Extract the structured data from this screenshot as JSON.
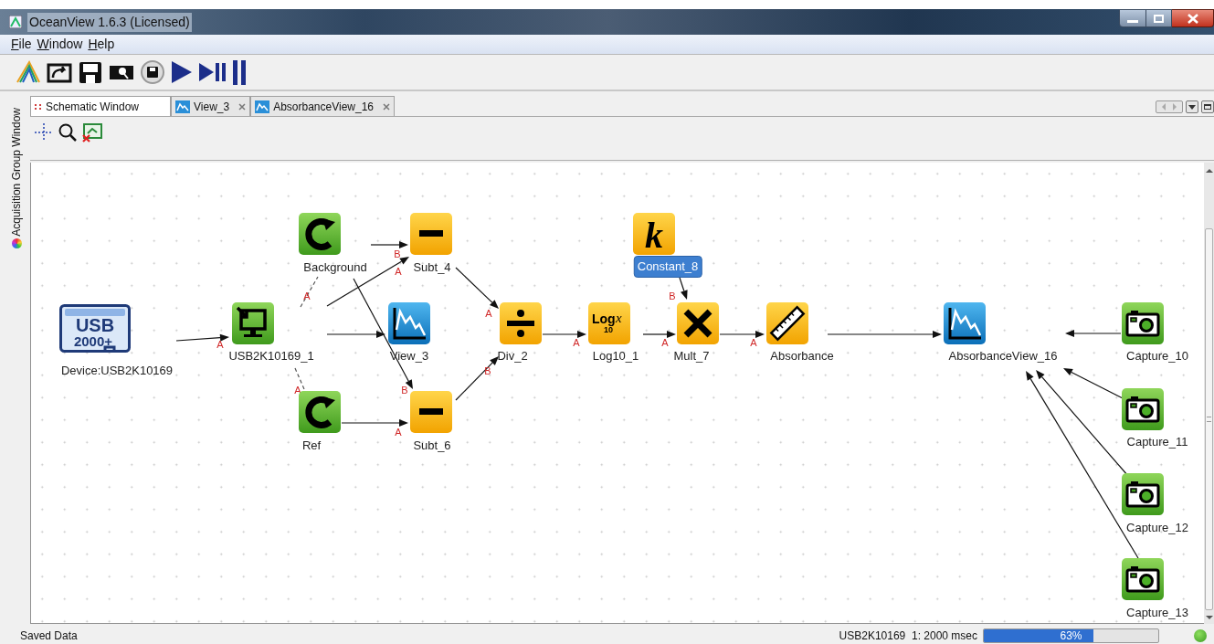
{
  "window": {
    "title": "OceanView 1.6.3 (Licensed)"
  },
  "menu": [
    {
      "label": "File"
    },
    {
      "label": "Window"
    },
    {
      "label": "Help"
    }
  ],
  "side_panel": {
    "label": "Acquisition Group Window"
  },
  "tabs": [
    {
      "label": "Schematic Window",
      "selected": true,
      "kind": "schematic"
    },
    {
      "label": "View_3",
      "selected": false,
      "kind": "view"
    },
    {
      "label": "AbsorbanceView_16",
      "selected": false,
      "kind": "view"
    }
  ],
  "nodes": [
    {
      "label": "Device:USB2K10169",
      "kind": "device",
      "icon_text": [
        "USB",
        "2000+"
      ],
      "selected": false
    },
    {
      "label": "USB2K10169_1",
      "kind": "acquire",
      "selected": false
    },
    {
      "label": "View_3",
      "kind": "view",
      "selected": false
    },
    {
      "label": "Background",
      "kind": "reference",
      "selected": false
    },
    {
      "label": "Ref",
      "kind": "reference",
      "selected": false
    },
    {
      "label": "Subt_4",
      "kind": "subtract",
      "selected": false
    },
    {
      "label": "Subt_6",
      "kind": "subtract",
      "selected": false
    },
    {
      "label": "Div_2",
      "kind": "divide",
      "selected": false
    },
    {
      "label": "Log10_1",
      "kind": "log",
      "icon_text": [
        "Log",
        "10",
        "x"
      ],
      "selected": false
    },
    {
      "label": "Constant_8",
      "kind": "constant",
      "icon_text": [
        "k"
      ],
      "selected": true
    },
    {
      "label": "Mult_7",
      "kind": "multiply",
      "selected": false
    },
    {
      "label": "Absorbance",
      "kind": "ruler",
      "selected": false
    },
    {
      "label": "AbsorbanceView_16",
      "kind": "view",
      "selected": false
    },
    {
      "label": "Capture_10",
      "kind": "capture",
      "selected": false
    },
    {
      "label": "Capture_11",
      "kind": "capture",
      "selected": false
    },
    {
      "label": "Capture_12",
      "kind": "capture",
      "selected": false
    },
    {
      "label": "Capture_13",
      "kind": "capture",
      "selected": false
    }
  ],
  "connections": [
    {
      "kind": "arrow",
      "port": "B"
    },
    {
      "kind": "arrow",
      "port": "A"
    },
    {
      "kind": "dashed",
      "port": "A"
    },
    {
      "kind": "arrow",
      "port": "B"
    },
    {
      "kind": "arrow",
      "port": "A"
    },
    {
      "kind": "arrow",
      "port": "A"
    },
    {
      "kind": "arrow",
      "port": "A"
    },
    {
      "kind": "arrow",
      "port": "A"
    },
    {
      "kind": "arrow",
      "port": "A"
    },
    {
      "kind": "arrow",
      "port": "B"
    },
    {
      "kind": "dashed",
      "port": "A"
    },
    {
      "kind": "arrow",
      "port": "B"
    },
    {
      "kind": "arrow",
      "port": "A"
    },
    {
      "kind": "arrow"
    },
    {
      "kind": "arrow"
    },
    {
      "kind": "arrow"
    },
    {
      "kind": "arrow"
    },
    {
      "kind": "arrow"
    },
    {
      "kind": "arrow"
    }
  ],
  "status_bar": {
    "message": "Saved Data",
    "device": "USB2K10169  1: 2000 msec",
    "progress": {
      "level": 0.63,
      "text": "63%"
    }
  }
}
